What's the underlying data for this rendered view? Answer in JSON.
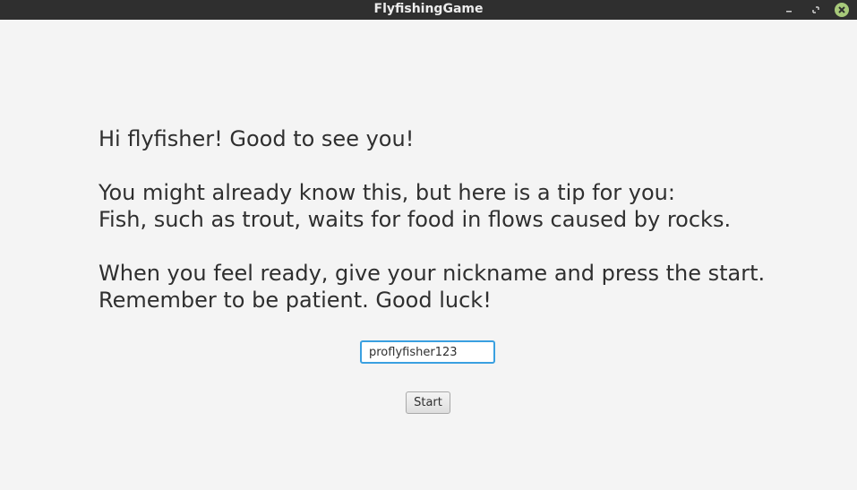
{
  "window": {
    "title": "FlyfishingGame"
  },
  "controls": {
    "minimize_icon": "minimize-icon",
    "maximize_icon": "maximize-icon",
    "close_icon": "close-icon",
    "close_color": "#a7c97a"
  },
  "message": {
    "greeting": "Hi flyfisher! Good to see you!",
    "tip_intro": "You might already know this, but here is a tip for you:",
    "tip_text": "Fish, such as trout, waits for food in flows caused by rocks.",
    "instructions": "When you feel ready, give your nickname and press the start.",
    "encouragement": "Remember to be patient. Good luck!"
  },
  "nickname": {
    "value": "proflyfisher123"
  },
  "start": {
    "label": "Start"
  },
  "colors": {
    "titlebar": "#2f2f2f",
    "background": "#f4f4f4",
    "focus_ring": "#3aa0e0",
    "text": "#2f2f2f"
  }
}
